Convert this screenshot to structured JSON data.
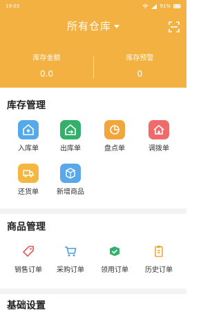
{
  "status": {
    "time": "19:03",
    "battery": "91%"
  },
  "header": {
    "title": "所有仓库"
  },
  "metrics": [
    {
      "label": "库存金额",
      "value": "0.0"
    },
    {
      "label": "库存预警",
      "value": "0"
    }
  ],
  "inventory": {
    "title": "库存管理",
    "items": [
      {
        "label": "入库单",
        "icon": "warehouse-up-icon",
        "color": "#55a9ea"
      },
      {
        "label": "出库单",
        "icon": "warehouse-out-icon",
        "color": "#33b16a"
      },
      {
        "label": "盘点单",
        "icon": "pie-chart-icon",
        "color": "#f2a53a"
      },
      {
        "label": "调拨单",
        "icon": "home-transfer-icon",
        "color": "#ef6b6b"
      },
      {
        "label": "还货单",
        "icon": "truck-icon",
        "color": "#f4b740"
      },
      {
        "label": "新增商品",
        "icon": "new-box-icon",
        "color": "#58a8ea"
      }
    ]
  },
  "products": {
    "title": "商品管理",
    "items": [
      {
        "label": "销售订单",
        "icon": "tag-icon",
        "color": "#e25757"
      },
      {
        "label": "采购订单",
        "icon": "cart-icon",
        "color": "#4a9be0"
      },
      {
        "label": "领用订单",
        "icon": "box-check-icon",
        "color": "#33b16a"
      },
      {
        "label": "历史订单",
        "icon": "clipboard-icon",
        "color": "#f0a830"
      }
    ]
  },
  "footer_section": {
    "title": "基础设置"
  }
}
